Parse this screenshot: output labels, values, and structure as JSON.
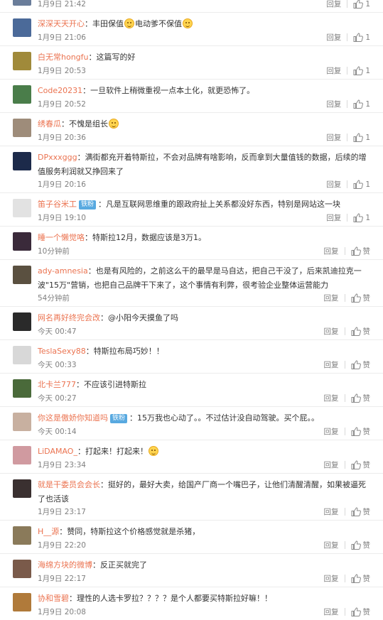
{
  "comments": [
    {
      "avatar_color": "#6a7d9a",
      "user": "",
      "badge": "",
      "text": "",
      "emoji_after_text": false,
      "time": "1月9日 21:42",
      "reply": "回复",
      "likes": "1"
    },
    {
      "avatar_color": "#4b6a99",
      "user": "深深天天开心",
      "badge": "",
      "text": "丰田保值",
      "emoji1": true,
      "text2": "电动爹不保值",
      "emoji2": true,
      "time": "1月9日 21:06",
      "reply": "回复",
      "likes": "1"
    },
    {
      "avatar_color": "#a08a3a",
      "user": "白无常hongfu",
      "badge": "",
      "text": "这篇写的好",
      "time": "1月9日 20:53",
      "reply": "回复",
      "likes": "1"
    },
    {
      "avatar_color": "#4a7d4a",
      "user": "Code20231",
      "badge": "",
      "text": "一旦软件上稍微重视一点本土化，就更恐怖了。",
      "time": "1月9日 20:52",
      "reply": "回复",
      "likes": "1"
    },
    {
      "avatar_color": "#9e8c7a",
      "user": "绣春瓜",
      "badge": "",
      "text": "不愧是组长",
      "emoji_end": true,
      "time": "1月9日 20:36",
      "reply": "回复",
      "likes": "1"
    },
    {
      "avatar_color": "#1c2a4a",
      "user": "DPxxxggg",
      "badge": "",
      "text": "满街都充开着特斯拉，不会对品牌有啥影响，反而拿到大量值钱的数据，后续的增值服务利润就又挣回来了",
      "time": "1月9日 20:16",
      "reply": "回复",
      "likes": "1"
    },
    {
      "avatar_color": "#e2e2e2",
      "user": "笛子谷米工",
      "badge": "铁粉",
      "text": "凡是互联网思维重的跟政府扯上关系都没好东西，特别是网站这一块",
      "time": "1月9日 19:10",
      "reply": "回复",
      "likes": "1"
    },
    {
      "avatar_color": "#3a2a3a",
      "user": "睡一个懒觉咯",
      "badge": "",
      "text": "特斯拉12月，数据应该是3万1。",
      "time": "10分钟前",
      "reply": "回复",
      "likes": "赞"
    },
    {
      "avatar_color": "#5a5040",
      "user": "ady-amnesia",
      "badge": "",
      "text": "也是有风险的，之前这么干的最早是马自达，把自己干没了，后来凯迪拉克一波\"15万\"营销，也把自己品牌干下来了，这个事情有利弊，很考验企业整体运营能力",
      "time": "54分钟前",
      "reply": "回复",
      "likes": "赞"
    },
    {
      "avatar_color": "#2a2a2a",
      "user": "网名再好终完会改",
      "badge": "",
      "text": "@小阳今天摸鱼了吗",
      "time": "今天 00:47",
      "reply": "回复",
      "likes": "赞"
    },
    {
      "avatar_color": "#d8d8d8",
      "user": "TeslaSexy88",
      "badge": "",
      "text": "特斯拉布局巧妙！！",
      "time": "今天 00:33",
      "reply": "回复",
      "likes": "赞"
    },
    {
      "avatar_color": "#4a6a3a",
      "user": "北卡兰777",
      "badge": "",
      "text": "不应该引进特斯拉",
      "time": "今天 00:27",
      "reply": "回复",
      "likes": "赞"
    },
    {
      "avatar_color": "#c8b0a0",
      "user": "你这是傲娇你知道吗",
      "badge": "铁粉",
      "text": "15万我也心动了。。不过估计没自动驾驶。买个屁。。",
      "time": "今天 00:14",
      "reply": "回复",
      "likes": "赞"
    },
    {
      "avatar_color": "#d09aa0",
      "user": "LiDAMAO_",
      "badge": "",
      "text": "打起来！打起来！",
      "emoji_end": true,
      "time": "1月9日 23:34",
      "reply": "回复",
      "likes": "赞"
    },
    {
      "avatar_color": "#3a3030",
      "user": "就是干委员会会长",
      "badge": "",
      "text": "挺好的，最好大卖，给国产厂商一个嘴巴子，让他们清醒清醒，如果被逼死了也活该",
      "time": "1月9日 23:17",
      "reply": "回复",
      "likes": "赞"
    },
    {
      "avatar_color": "#8a7a5a",
      "user": "H__源",
      "badge": "",
      "text": "赞同，特斯拉这个价格感觉就是杀猪，",
      "time": "1月9日 22:20",
      "reply": "回复",
      "likes": "赞"
    },
    {
      "avatar_color": "#7a5a4a",
      "user": "海绵方块的微博",
      "badge": "",
      "text": "反正买就完了",
      "time": "1月9日 22:17",
      "reply": "回复",
      "likes": "赞"
    },
    {
      "avatar_color": "#b07a3a",
      "user": "协和雪碧",
      "badge": "",
      "text": "理性的人选卡罗拉？？？？是个人都要买特斯拉好嘛！！",
      "time": "1月9日 20:08",
      "reply": "回复",
      "likes": "赞"
    }
  ]
}
